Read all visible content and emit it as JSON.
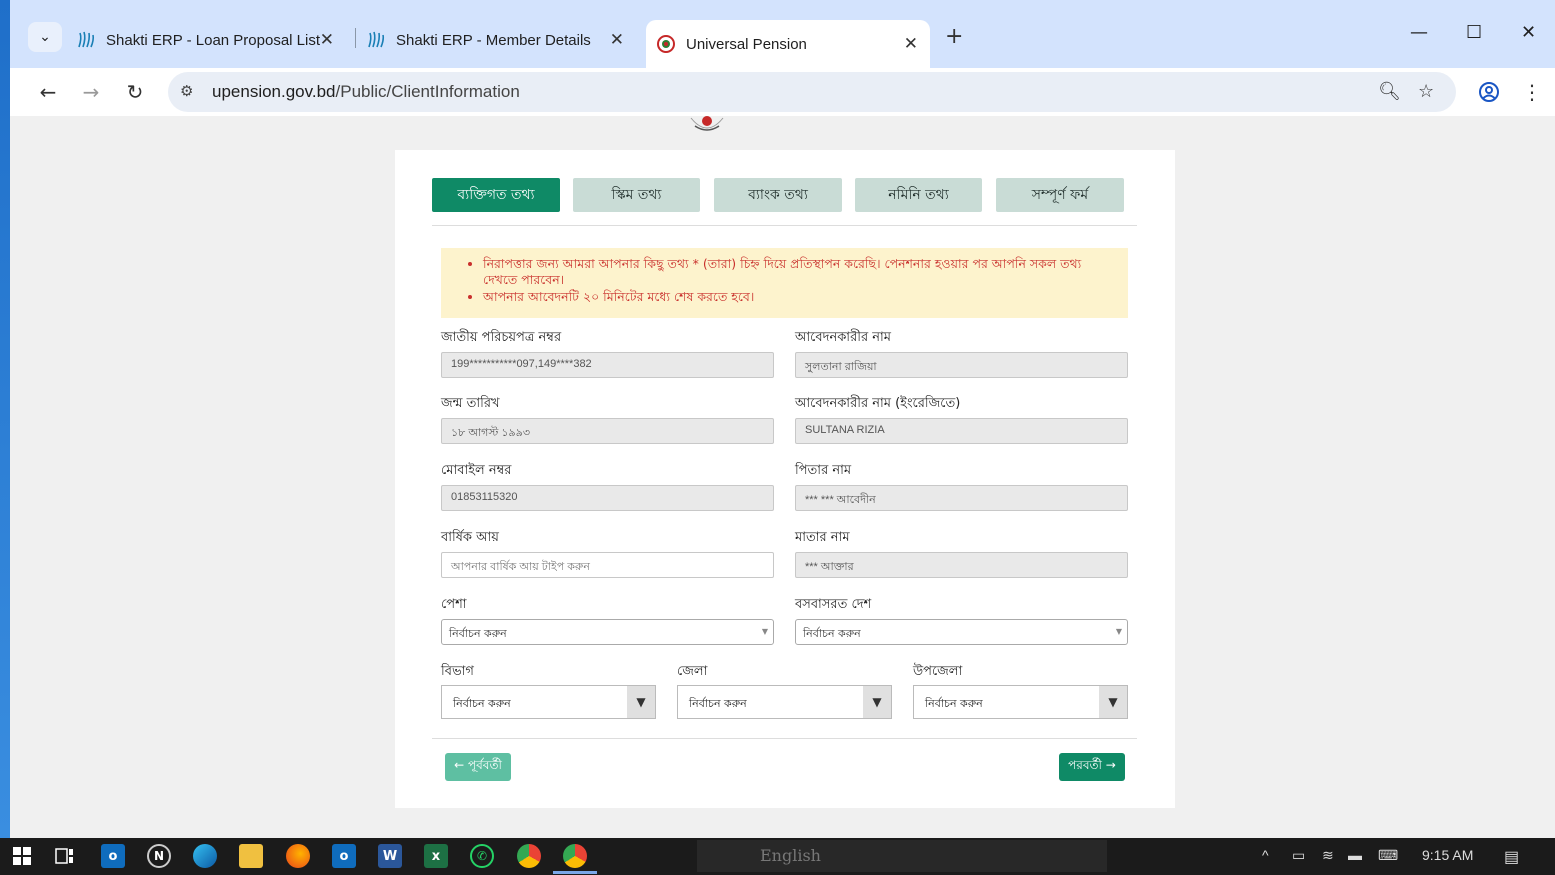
{
  "browser": {
    "tabs": [
      {
        "title": "Shakti ERP - Loan Proposal List",
        "active": false
      },
      {
        "title": "Shakti ERP - Member Details",
        "active": false
      },
      {
        "title": "Universal Pension",
        "active": true
      }
    ],
    "url_host": "upension.gov.bd",
    "url_path": "/Public/ClientInformation"
  },
  "steps": [
    {
      "label": "ব্যক্তিগত তথ্য",
      "active": true
    },
    {
      "label": "স্কিম তথ্য",
      "active": false
    },
    {
      "label": "ব্যাংক তথ্য",
      "active": false
    },
    {
      "label": "নমিনি তথ্য",
      "active": false
    },
    {
      "label": "সম্পূর্ণ ফর্ম",
      "active": false
    }
  ],
  "notice": [
    "নিরাপত্তার জন্য আমরা আপনার কিছু তথ্য * (তারা) চিহ্ন দিয়ে প্রতিস্থাপন করেছি। পেনশনার হওয়ার পর আপনি সকল তথ্য দেখতে পারবেন।",
    "আপনার আবেদনটি ২০ মিনিটের মধ্যে শেষ করতে হবে।"
  ],
  "form": {
    "nid": {
      "label": "জাতীয় পরিচয়পত্র নম্বর",
      "value": "199***********097,149****382"
    },
    "applicant_name": {
      "label": "আবেদনকারীর নাম",
      "value": "সুলতানা রাজিয়া"
    },
    "dob": {
      "label": "জন্ম তারিখ",
      "value": "১৮ আগস্ট ১৯৯৩"
    },
    "applicant_name_en": {
      "label": "আবেদনকারীর নাম (ইংরেজিতে)",
      "value": "SULTANA RIZIA"
    },
    "mobile": {
      "label": "মোবাইল নম্বর",
      "value": "01853115320"
    },
    "father_name": {
      "label": "পিতার নাম",
      "value": "*** *** আবেদীন"
    },
    "annual_income": {
      "label": "বার্ষিক আয়",
      "placeholder": "আপনার বার্ষিক আয় টাইপ করুন"
    },
    "mother_name": {
      "label": "মাতার নাম",
      "value": "*** আক্তার"
    },
    "occupation": {
      "label": "পেশা",
      "value": "নির্বাচন করুন"
    },
    "country": {
      "label": "বসবাসরত দেশ",
      "value": "নির্বাচন করুন"
    },
    "division": {
      "label": "বিভাগ",
      "value": "নির্বাচন করুন"
    },
    "district": {
      "label": "জেলা",
      "value": "নির্বাচন করুন"
    },
    "upazila": {
      "label": "উপজেলা",
      "value": "নির্বাচন করুন"
    }
  },
  "buttons": {
    "prev": "← পূর্ববর্তী",
    "next": "পরবর্তী →"
  },
  "taskbar": {
    "language": "English",
    "time": "9:15 AM"
  }
}
